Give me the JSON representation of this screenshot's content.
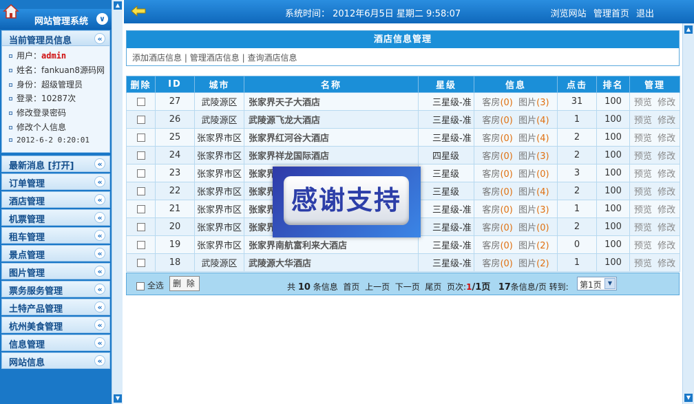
{
  "sidebar": {
    "title": "网站管理系统",
    "info_title": "当前管理员信息",
    "info": {
      "user_label": "用户：",
      "user_value": "admin",
      "name": "姓名：fankuan8源码网",
      "role": "身份：超级管理员",
      "login_count": "登录：10287次",
      "change_password": "修改登录密码",
      "edit_profile": "修改个人信息",
      "datetime": "2012-6-2 0:20:01"
    },
    "menus": [
      "最新消息 [打开]",
      "订单管理",
      "酒店管理",
      "机票管理",
      "租车管理",
      "景点管理",
      "图片管理",
      "票务服务管理",
      "土特产品管理",
      "杭州美食管理",
      "信息管理",
      "网站信息"
    ]
  },
  "topbar": {
    "time": "系统时间： 2012年6月5日 星期二 9:58:07",
    "links": [
      "浏览网站",
      "管理首页",
      "退出"
    ]
  },
  "panel": {
    "title": "酒店信息管理",
    "links": [
      "添加酒店信息",
      "管理酒店信息",
      "查询酒店信息"
    ],
    "separator": "|"
  },
  "table": {
    "headers": [
      "删除",
      "ID",
      "城市",
      "名称",
      "星级",
      "信息",
      "点击",
      "排名",
      "管理"
    ],
    "room_label": "客房",
    "photo_label": "图片",
    "preview_label": "预览",
    "edit_label": "修改",
    "rows": [
      {
        "id": "27",
        "city": "武陵源区",
        "name": "张家界天子大酒店",
        "star": "三星级-准",
        "rooms": "(0)",
        "photos": "(3)",
        "clicks": "31",
        "rank": "100"
      },
      {
        "id": "26",
        "city": "武陵源区",
        "name": "武陵源飞龙大酒店",
        "star": "三星级-准",
        "rooms": "(0)",
        "photos": "(4)",
        "clicks": "1",
        "rank": "100"
      },
      {
        "id": "25",
        "city": "张家界市区",
        "name": "张家界红河谷大酒店",
        "star": "三星级-准",
        "rooms": "(0)",
        "photos": "(4)",
        "clicks": "2",
        "rank": "100"
      },
      {
        "id": "24",
        "city": "张家界市区",
        "name": "张家界祥龙国际酒店",
        "star": "四星级",
        "rooms": "(0)",
        "photos": "(3)",
        "clicks": "2",
        "rank": "100"
      },
      {
        "id": "23",
        "city": "张家界市区",
        "name": "张家界",
        "star": "三星级",
        "rooms": "(0)",
        "photos": "(0)",
        "clicks": "3",
        "rank": "100"
      },
      {
        "id": "22",
        "city": "张家界市区",
        "name": "张家界",
        "star": "三星级",
        "rooms": "(0)",
        "photos": "(4)",
        "clicks": "2",
        "rank": "100"
      },
      {
        "id": "21",
        "city": "张家界市区",
        "name": "张家界",
        "star": "三星级-准",
        "rooms": "(0)",
        "photos": "(3)",
        "clicks": "1",
        "rank": "100"
      },
      {
        "id": "20",
        "city": "张家界市区",
        "name": "张家界",
        "star": "三星级-准",
        "rooms": "(0)",
        "photos": "(0)",
        "clicks": "2",
        "rank": "100"
      },
      {
        "id": "19",
        "city": "张家界市区",
        "name": "张家界南航富利来大酒店",
        "star": "三星级-准",
        "rooms": "(0)",
        "photos": "(2)",
        "clicks": "0",
        "rank": "100"
      },
      {
        "id": "18",
        "city": "武陵源区",
        "name": "武陵源大华酒店",
        "star": "三星级-准",
        "rooms": "(0)",
        "photos": "(2)",
        "clicks": "1",
        "rank": "100"
      }
    ]
  },
  "footer": {
    "select_all": "全选",
    "delete_button": "删 除",
    "pager": {
      "total_prefix": "共",
      "total": "10",
      "total_suffix": "条信息",
      "first": "首页",
      "prev": "上一页",
      "next": "下一页",
      "last": "尾页",
      "page_label": "页次:",
      "current": "1",
      "pages": "/1页",
      "per_page": "17",
      "per_page_suffix": "条信息/页",
      "goto_label": "转到:"
    },
    "page_select": "第1页"
  },
  "banner": {
    "text": "感谢支持"
  }
}
